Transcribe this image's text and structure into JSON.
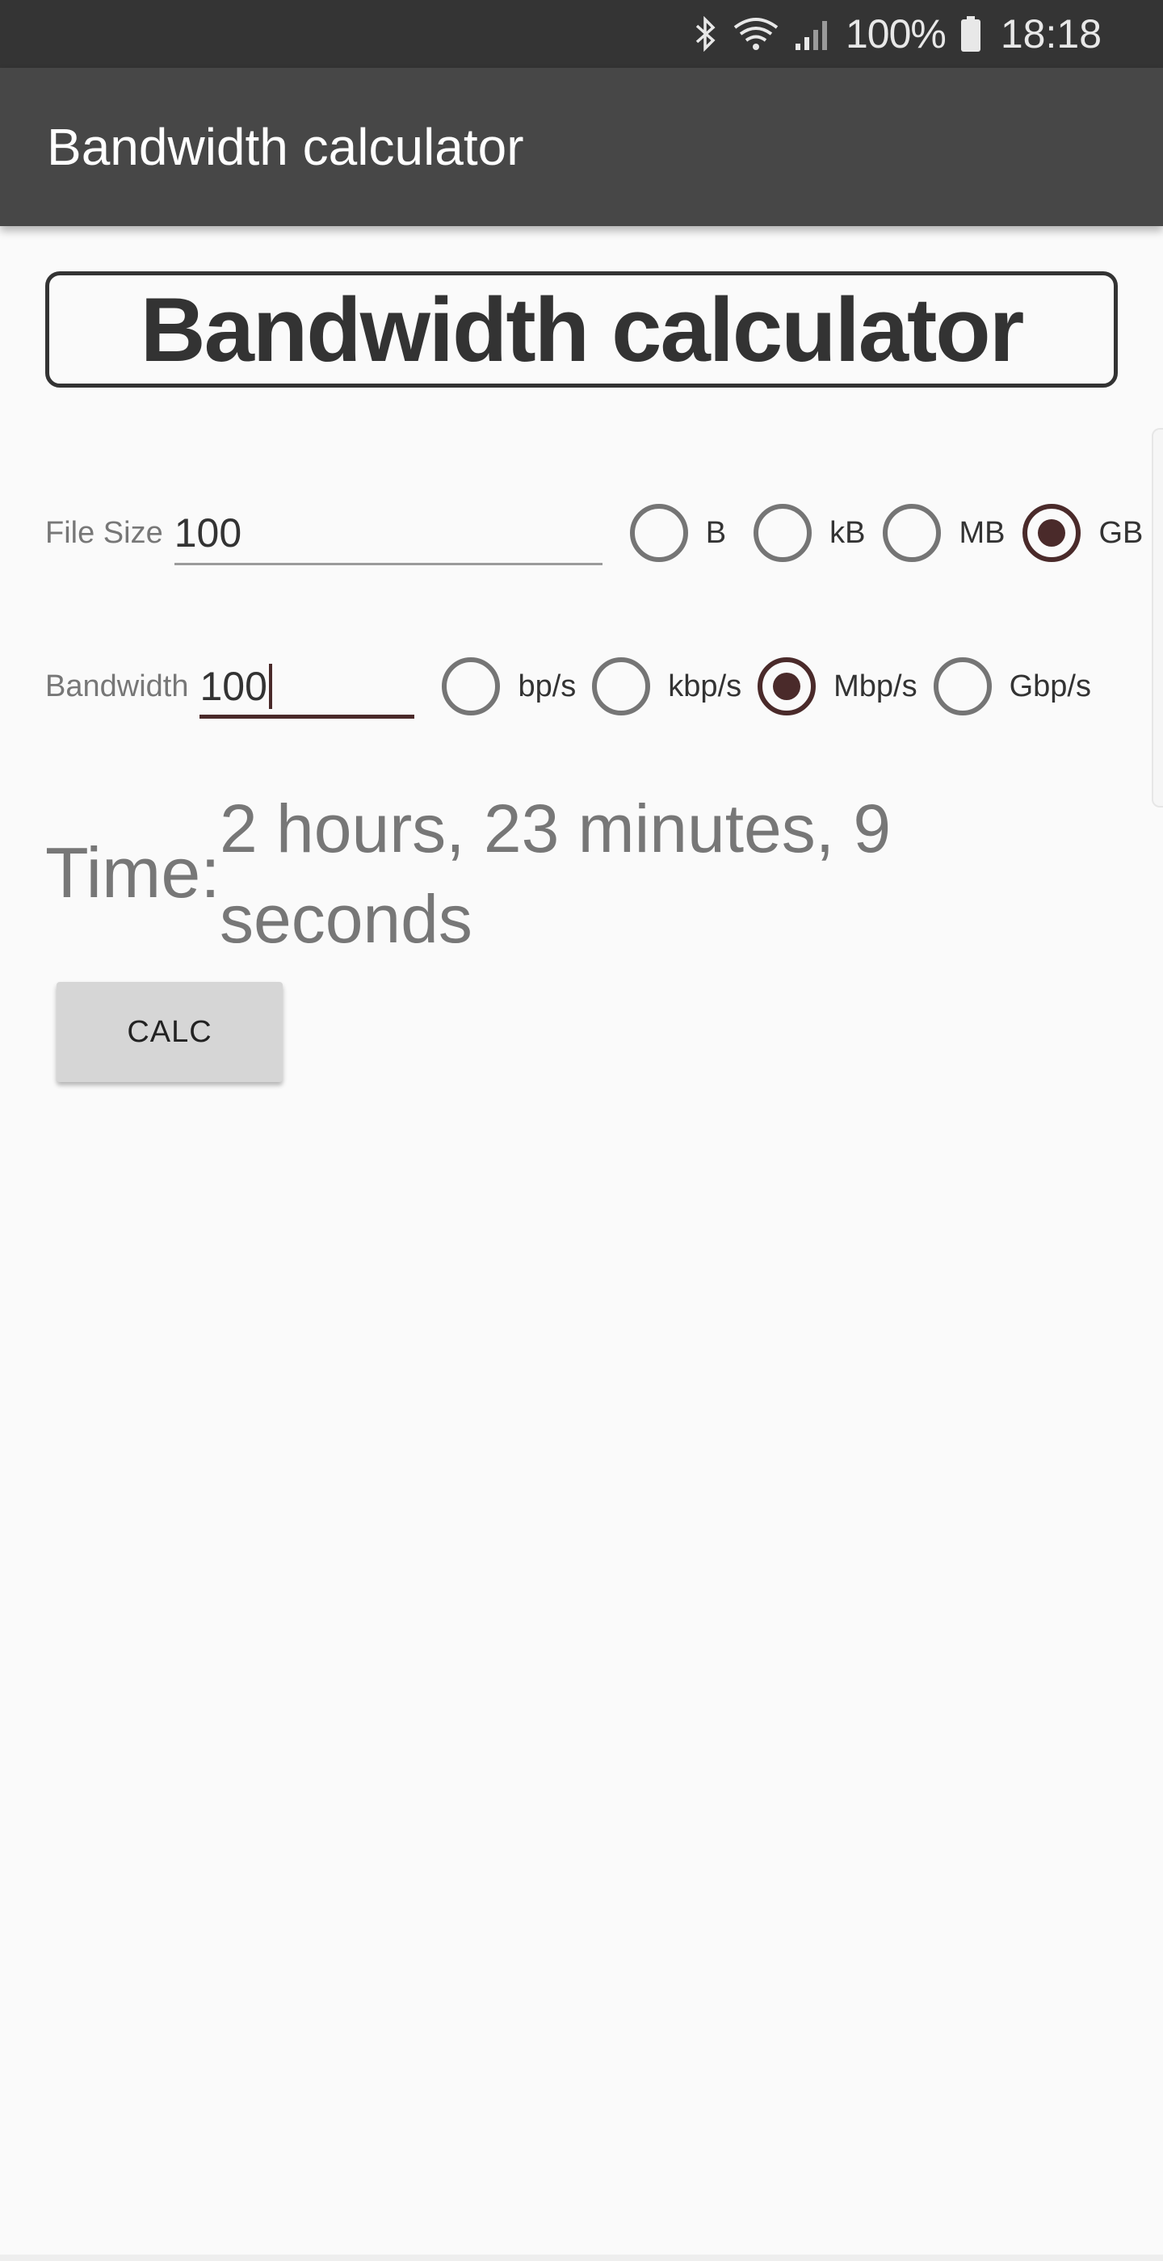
{
  "status_bar": {
    "battery_percent": "100%",
    "time": "18:18",
    "icons": [
      "bluetooth-icon",
      "wifi-icon",
      "signal-icon",
      "battery-icon"
    ]
  },
  "app_bar": {
    "title": "Bandwidth calculator"
  },
  "header": {
    "title": "Bandwidth calculator"
  },
  "file_size": {
    "label": "File Size",
    "value": "100",
    "units": [
      "B",
      "kB",
      "MB",
      "GB"
    ],
    "selected": "GB"
  },
  "bandwidth": {
    "label": "Bandwidth",
    "value": "100",
    "units": [
      "bp/s",
      "kbp/s",
      "Mbp/s",
      "Gbp/s"
    ],
    "selected": "Mbp/s"
  },
  "result": {
    "label": "Time:",
    "value": "2 hours, 23 minutes, 9 seconds"
  },
  "calc_button": {
    "label": "CALC"
  },
  "colors": {
    "status_bar": "#343434",
    "app_bar": "#474747",
    "accent": "#4a2a2a",
    "background": "#fafafa"
  }
}
